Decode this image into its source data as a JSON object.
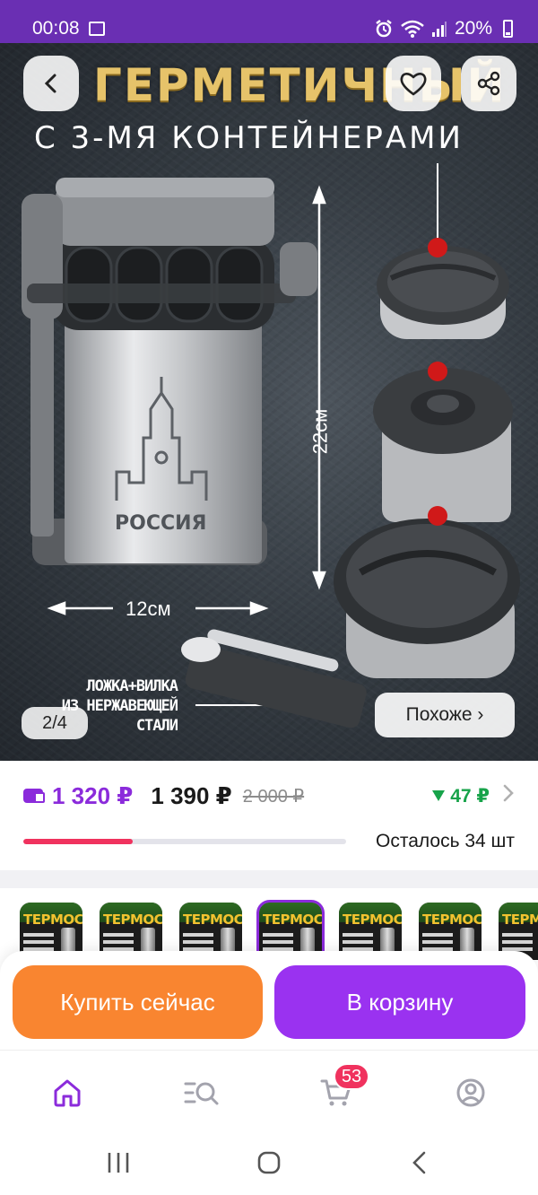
{
  "status_bar": {
    "time": "00:08",
    "battery": "20%"
  },
  "hero": {
    "headline": "ГЕРМЕТИЧНЫЙ",
    "subheadline": "С 3-МЯ КОНТЕЙНЕРАМИ",
    "height_label": "22см",
    "width_label": "12см",
    "product_print": "РОССИЯ",
    "caption_lines": [
      "ЛОЖКА+ВИЛКА",
      "ИЗ НЕРЖАВЕЮЩЕЙ",
      "СТАЛИ"
    ],
    "page_indicator": "2/4",
    "similar_label": "Похоже ›"
  },
  "price": {
    "wallet_price": "1 320 ₽",
    "price": "1 390 ₽",
    "old_price": "2 000 ₽",
    "diff": "47 ₽",
    "diff_direction": "down",
    "stock_text": "Осталось 34 шт",
    "stock_fraction": 0.34
  },
  "thumbnails": [
    {
      "title": "ТЕРМОС",
      "active": false
    },
    {
      "title": "ТЕРМОС",
      "active": false
    },
    {
      "title": "ТЕРМОС",
      "active": false
    },
    {
      "title": "ТЕРМОС",
      "active": true
    },
    {
      "title": "ТЕРМОС",
      "active": false
    },
    {
      "title": "ТЕРМОС",
      "active": false
    },
    {
      "title": "ТЕРМОС",
      "active": false
    }
  ],
  "actions": {
    "buy_now": "Купить сейчас",
    "add_to_cart": "В корзину"
  },
  "bottom_nav": {
    "cart_badge": "53",
    "active": "home"
  },
  "colors": {
    "status_bar": "#6a2fb3",
    "brand_purple": "#8b2bdb",
    "buy_orange": "#f98530",
    "cart_purple": "#9a32f0",
    "accent_red": "#f0325e",
    "diff_green": "#17a34a"
  }
}
